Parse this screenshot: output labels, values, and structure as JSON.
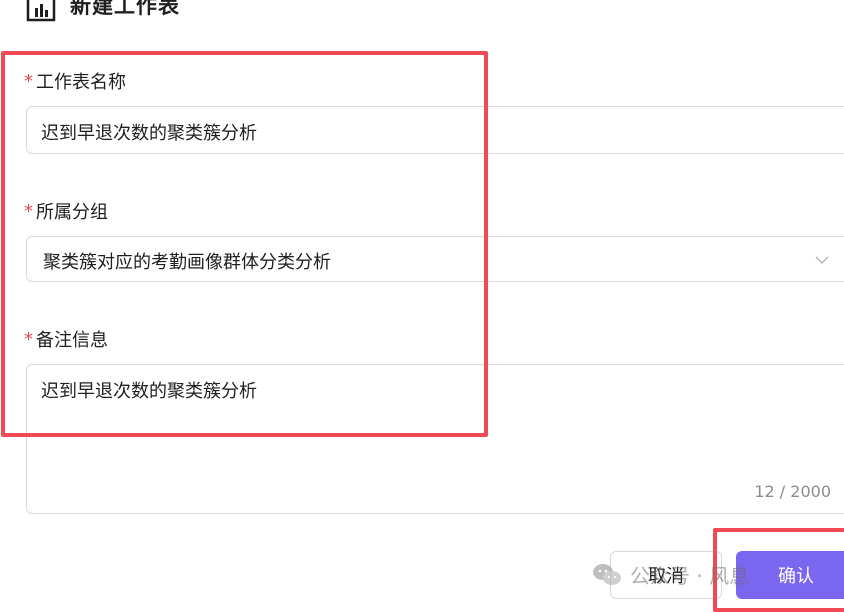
{
  "dialog": {
    "title": "新建工作表"
  },
  "form": {
    "sheet_name": {
      "label": "工作表名称",
      "required_mark": "*",
      "value": "迟到早退次数的聚类簇分析"
    },
    "group": {
      "label": "所属分组",
      "required_mark": "*",
      "selected": "聚类簇对应的考勤画像群体分类分析"
    },
    "remark": {
      "label": "备注信息",
      "required_mark": "*",
      "value": "迟到早退次数的聚类簇分析",
      "counter": "12 / 2000"
    }
  },
  "footer": {
    "cancel_label": "取消",
    "confirm_label": "确认"
  },
  "watermark": {
    "text": "公众号 · 风息"
  },
  "colors": {
    "accent": "#7b66ef",
    "required": "#e5484d",
    "highlight": "#f04b55",
    "border": "#d9d9d9"
  },
  "icons": {
    "header": "bar-chart-icon",
    "select": "chevron-down-icon",
    "watermark": "wechat-icon"
  }
}
